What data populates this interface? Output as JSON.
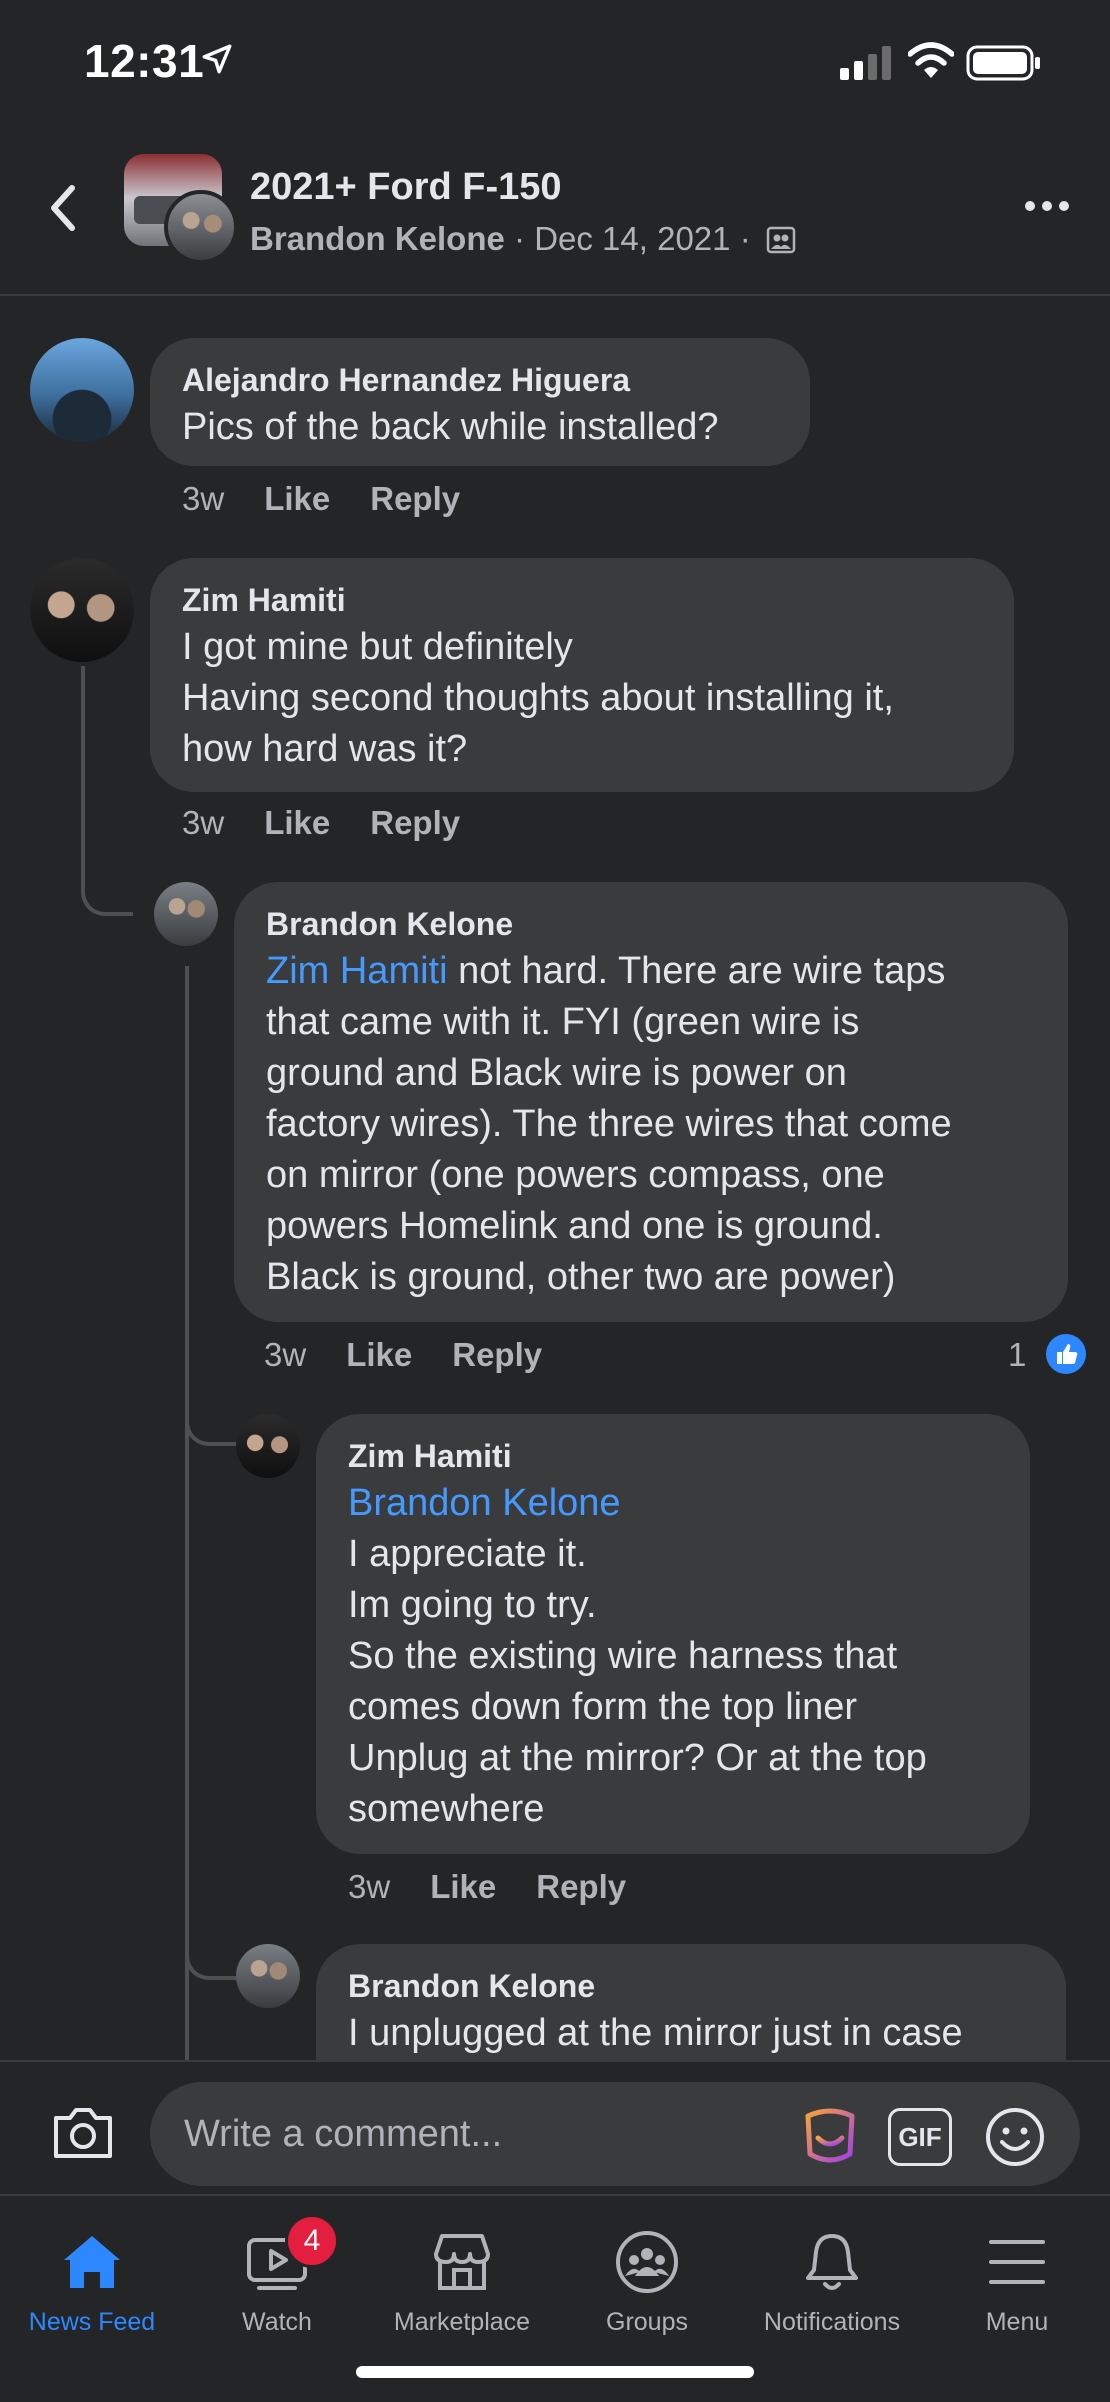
{
  "status_bar": {
    "time": "12:31"
  },
  "header": {
    "group_name": "2021+ Ford F-150",
    "author": "Brandon Kelone",
    "separator": "·",
    "date": "Dec 14, 2021"
  },
  "comments": [
    {
      "name": "Alejandro Hernandez Higuera",
      "text": "Pics of the back while installed?",
      "time": "3w",
      "like": "Like",
      "reply": "Reply"
    },
    {
      "name": "Zim Hamiti",
      "text": "I got mine but definitely\nHaving second thoughts about installing it,\nhow hard was it?",
      "time": "3w",
      "like": "Like",
      "reply": "Reply"
    },
    {
      "name": "Brandon Kelone",
      "mention": "Zim Hamiti",
      "text": " not hard. There are wire taps\nthat came with it. FYI (green wire is\nground and Black wire is power on\nfactory wires). The three wires that come\non mirror (one powers compass, one\npowers Homelink and one is ground.\nBlack is ground, other two are power)",
      "time": "3w",
      "like": "Like",
      "reply": "Reply",
      "reaction_count": "1"
    },
    {
      "name": "Zim Hamiti",
      "mention": "Brandon Kelone",
      "text": "I appreciate it.\nIm going to try.\nSo the existing wire harness that\ncomes down form the top liner\nUnplug at the mirror? Or at the top\nsomewhere",
      "time": "3w",
      "like": "Like",
      "reply": "Reply"
    },
    {
      "name": "Brandon Kelone",
      "text": "I unplugged at the mirror just in case"
    }
  ],
  "composer": {
    "placeholder": "Write a comment...",
    "gif_label": "GIF"
  },
  "tabs": [
    {
      "label": "News Feed",
      "icon": "home-icon",
      "active": true
    },
    {
      "label": "Watch",
      "icon": "watch-icon",
      "badge": "4"
    },
    {
      "label": "Marketplace",
      "icon": "marketplace-icon"
    },
    {
      "label": "Groups",
      "icon": "groups-icon"
    },
    {
      "label": "Notifications",
      "icon": "bell-icon"
    },
    {
      "label": "Menu",
      "icon": "menu-icon"
    }
  ],
  "colors": {
    "background": "#242526",
    "bubble": "#3a3b3c",
    "accent": "#2d88ff",
    "mention": "#4599ff",
    "badge": "#e41e3f"
  }
}
